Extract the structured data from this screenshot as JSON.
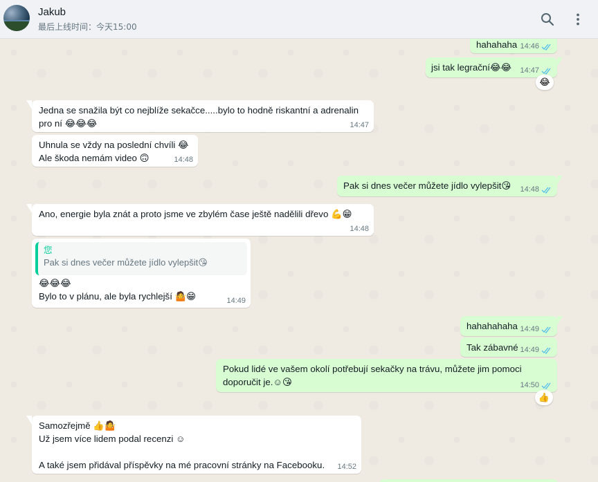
{
  "header": {
    "contact_name": "Jakub",
    "last_seen": "最后上线时间：今天15:00"
  },
  "messages": [
    {
      "dir": "out",
      "text": "hahahaha",
      "time": "14:46"
    },
    {
      "dir": "out",
      "text": "jsi tak legrační😂😂",
      "time": "14:47",
      "reaction": "😂"
    },
    {
      "dir": "in",
      "text": "Jedna se snažila být co nejblíže sekačce.....bylo to hodně riskantní a adrenalin\npro ní 😂😂😂",
      "time": "14:47"
    },
    {
      "dir": "in",
      "text": "Uhnula se vždy na poslední chvíli 😂\nAle škoda nemám video 🙃",
      "time": "14:48"
    },
    {
      "dir": "out",
      "text": "Pak si dnes večer můžete jídlo vylepšit😘",
      "time": "14:48"
    },
    {
      "dir": "in",
      "text": "Ano, energie byla znát a proto jsme ve zbylém čase ještě nadělili dřevo 💪😁",
      "time": "14:48"
    },
    {
      "dir": "in",
      "quote_author": "您",
      "quote_text": "Pak si dnes večer můžete jídlo vylepšit😘",
      "text": "😂😂😂\nBylo to v plánu, ale byla rychlejší 🤷😁",
      "time": "14:49"
    },
    {
      "dir": "out",
      "text": "hahahahaha",
      "time": "14:49"
    },
    {
      "dir": "out",
      "text": "Tak zábavné",
      "time": "14:49"
    },
    {
      "dir": "out",
      "text": "Pokud lidé ve vašem okolí potřebují sekačky na trávu, můžete jim pomoci\ndoporučit je.☺😘",
      "time": "14:50",
      "reaction": "👍"
    },
    {
      "dir": "in",
      "text": "Samozřejmě 👍🤷\nUž jsem více lidem podal recenzi ☺\n\nA také jsem přidával příspěvky na mé pracovní stránky na Facebooku.",
      "time": "14:52"
    }
  ],
  "colors": {
    "outgoing_bubble": "#d9fdd3",
    "incoming_bubble": "#ffffff",
    "read_ticks": "#53bdeb",
    "quote_accent": "#06cf9c"
  },
  "icons": [
    "search-icon",
    "menu-icon",
    "double-check-icon"
  ]
}
